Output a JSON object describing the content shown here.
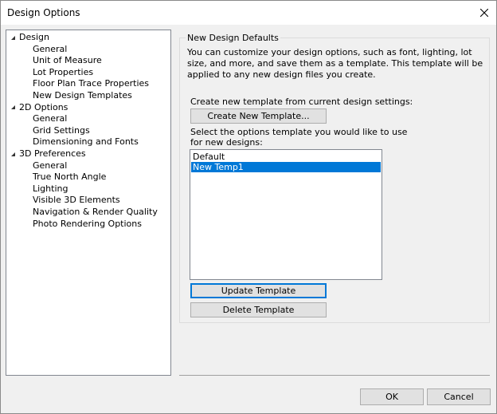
{
  "window": {
    "title": "Design Options"
  },
  "tree": [
    {
      "label": "Design",
      "level": 0,
      "expanded": true
    },
    {
      "label": "General",
      "level": 1
    },
    {
      "label": "Unit of Measure",
      "level": 1
    },
    {
      "label": "Lot Properties",
      "level": 1
    },
    {
      "label": "Floor Plan Trace Properties",
      "level": 1
    },
    {
      "label": "New Design Templates",
      "level": 1,
      "selected": true
    },
    {
      "label": "2D Options",
      "level": 0,
      "expanded": true
    },
    {
      "label": "General",
      "level": 1
    },
    {
      "label": "Grid Settings",
      "level": 1
    },
    {
      "label": "Dimensioning and Fonts",
      "level": 1
    },
    {
      "label": "3D Preferences",
      "level": 0,
      "expanded": true
    },
    {
      "label": "General",
      "level": 1
    },
    {
      "label": "True North Angle",
      "level": 1
    },
    {
      "label": "Lighting",
      "level": 1
    },
    {
      "label": "Visible 3D Elements",
      "level": 1
    },
    {
      "label": "Navigation & Render Quality",
      "level": 1
    },
    {
      "label": "Photo Rendering Options",
      "level": 1
    }
  ],
  "panel": {
    "group_title": "New Design Defaults",
    "description": "You can customize your design options, such as font, lighting, lot size, and more, and save them as a template. This template will be applied to any new design files you create.",
    "create_label": "Create new template from current design settings:",
    "create_button": "Create New Template...",
    "select_label_1": "Select the options template you would like to use",
    "select_label_2": "for new designs:",
    "templates": [
      "Default",
      "New Temp1"
    ],
    "selected_template": "New Temp1",
    "update_button": "Update Template",
    "delete_button": "Delete Template"
  },
  "footer": {
    "ok": "OK",
    "cancel": "Cancel"
  }
}
